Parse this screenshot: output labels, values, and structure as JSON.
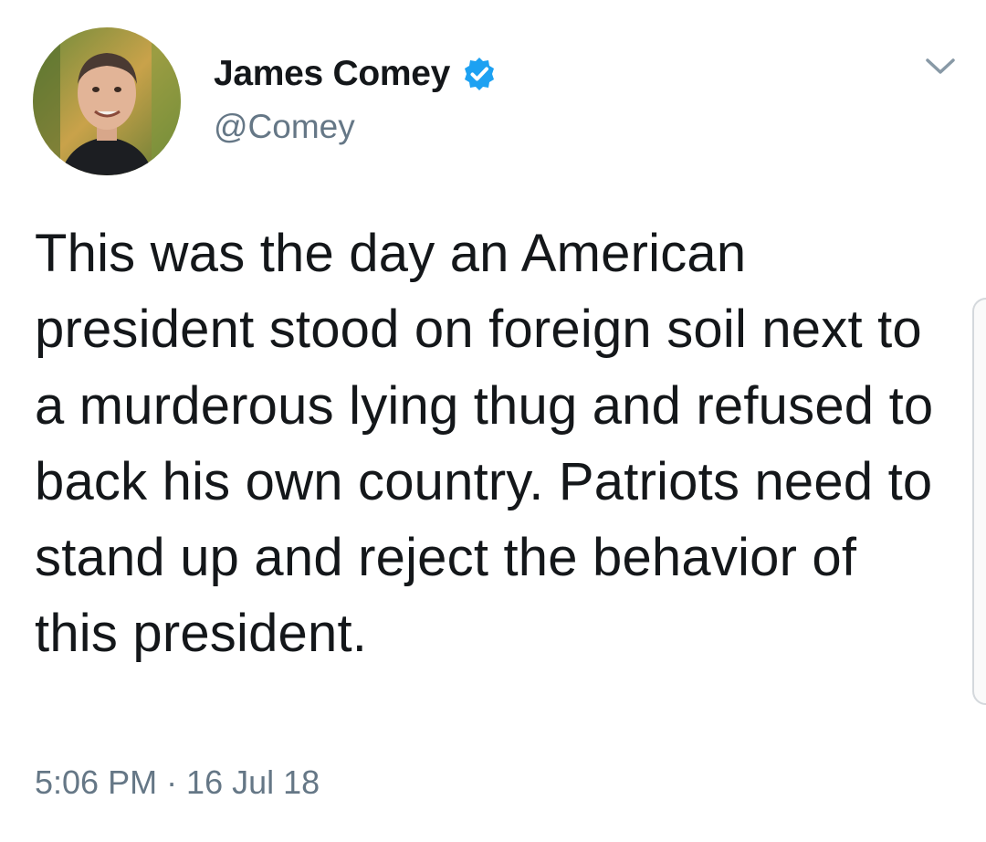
{
  "user": {
    "display_name": "James Comey",
    "handle": "@Comey",
    "verified": true,
    "avatar_icon": "profile-photo"
  },
  "tweet": {
    "text": "This was the day an American president stood on foreign soil next to a murderous lying thug and refused to back his own country.  Patriots need to stand up and reject the behavior of this president.",
    "timestamp": "5:06 PM · 16 Jul 18"
  },
  "icons": {
    "verified": "verified-badge-icon",
    "menu": "chevron-down-icon"
  },
  "colors": {
    "text": "#14171a",
    "secondary": "#657786",
    "verified_blue": "#1da1f2"
  }
}
